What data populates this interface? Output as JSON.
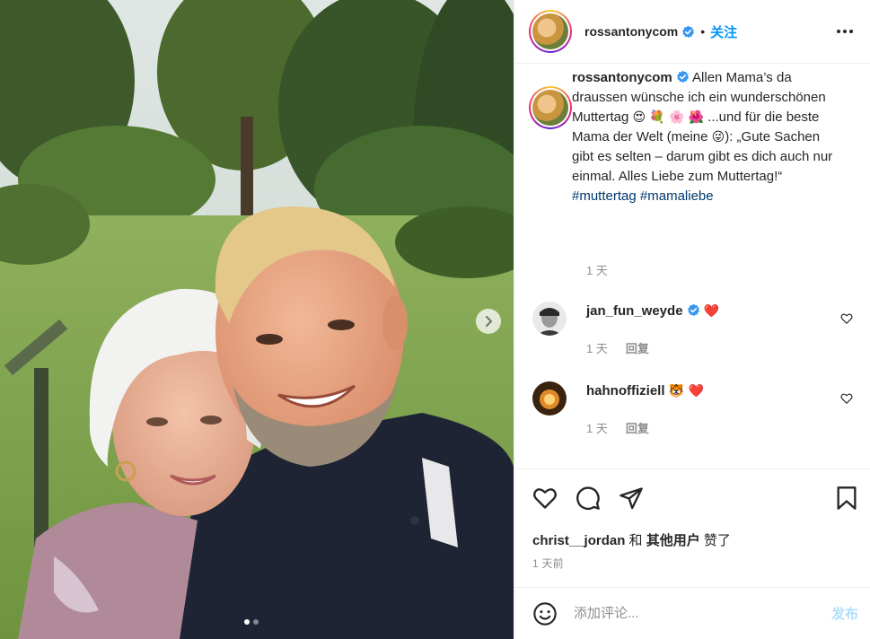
{
  "photo": {
    "carousel_dots": 2,
    "active_dot": 0
  },
  "header": {
    "username": "rossantonycom",
    "separator": "•",
    "follow_label": "关注"
  },
  "caption": {
    "username": "rossantonycom",
    "line1": "Allen Mama’s da draussen wünsche ich ein wunderschönen Muttertag",
    "emoji1": "😍",
    "emoji2": "💐",
    "emoji3": "🌸",
    "emoji4": "🌺",
    "line2": "...und für die beste Mama der Welt (meine",
    "emoji5": "😜",
    "line3": "): „Gute Sachen gibt es selten – darum gibt es dich auch nur einmal. Alles Liebe zum Muttertag!“",
    "hashtag1": "#muttertag",
    "hashtag2": "#mamaliebe",
    "time": "1 天"
  },
  "comments": [
    {
      "username": "jan_fun_weyde",
      "text": "❤️",
      "verified": true,
      "time": "1 天",
      "reply_label": "回复"
    },
    {
      "username": "hahnoffiziell",
      "text": "🐯 ❤️",
      "verified": false,
      "time": "1 天",
      "reply_label": "回复"
    }
  ],
  "likes": {
    "user": "christ__jordan",
    "conj": "和",
    "others": "其他用户",
    "suffix": "赞了"
  },
  "post_time": "1 天前",
  "add_comment": {
    "placeholder": "添加评论...",
    "post_label": "发布"
  },
  "colors": {
    "accent": "#0095f6",
    "hashtag": "#00376b",
    "muted": "#8e8e8e",
    "verified": "#3897f0",
    "heart": "#ed4956",
    "post_disabled": "#b2dffc"
  },
  "icons": [
    "chevron-right-icon",
    "more-icon",
    "verified-icon",
    "heart-icon",
    "comment-icon",
    "share-icon",
    "bookmark-icon",
    "emoji-icon"
  ]
}
